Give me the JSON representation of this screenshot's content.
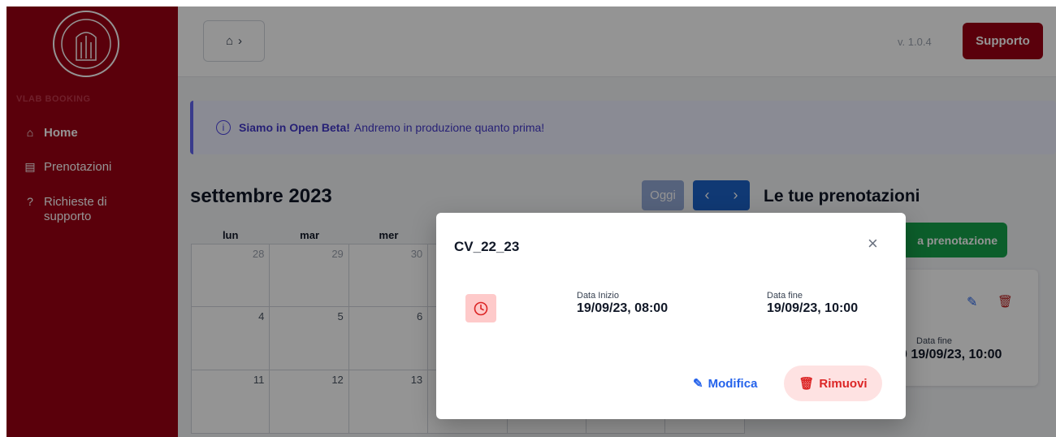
{
  "sidebar": {
    "brand": "VLAB BOOKING",
    "items": [
      {
        "label": "Home",
        "icon": "home-icon",
        "active": true
      },
      {
        "label": "Prenotazioni",
        "icon": "document-icon",
        "active": false
      },
      {
        "label": "Richieste di supporto",
        "icon": "question-icon",
        "active": false
      }
    ]
  },
  "topbar": {
    "breadcrumb_icon": "home-icon",
    "version": "v. 1.0.4",
    "support_label": "Supporto"
  },
  "banner": {
    "bold": "Siamo in Open Beta!",
    "text": "Andremo in produzione quanto prima!"
  },
  "calendar": {
    "title": "settembre 2023",
    "today_label": "Oggi",
    "weekdays": [
      "lun",
      "mar",
      "mer",
      "",
      "",
      "",
      ""
    ],
    "rows": [
      [
        "28",
        "29",
        "30",
        "",
        "",
        "",
        ""
      ],
      [
        "4",
        "5",
        "6",
        "",
        "",
        "",
        ""
      ],
      [
        "11",
        "12",
        "13",
        "",
        "",
        "",
        ""
      ]
    ]
  },
  "bookings": {
    "title": "Le tue prenotazioni",
    "new_label": "a prenotazione",
    "card": {
      "end_label": "Data fine",
      "end_value": "0 19/09/23, 10:00"
    }
  },
  "modal": {
    "title": "CV_22_23",
    "start_label": "Data Inizio",
    "start_value": "19/09/23, 08:00",
    "end_label": "Data fine",
    "end_value": "19/09/23, 10:00",
    "edit_label": "Modifica",
    "remove_label": "Rimuovi"
  },
  "colors": {
    "primary": "#9b0014",
    "blue": "#1d62c9",
    "green": "#16a34a",
    "danger": "#dc2626"
  }
}
